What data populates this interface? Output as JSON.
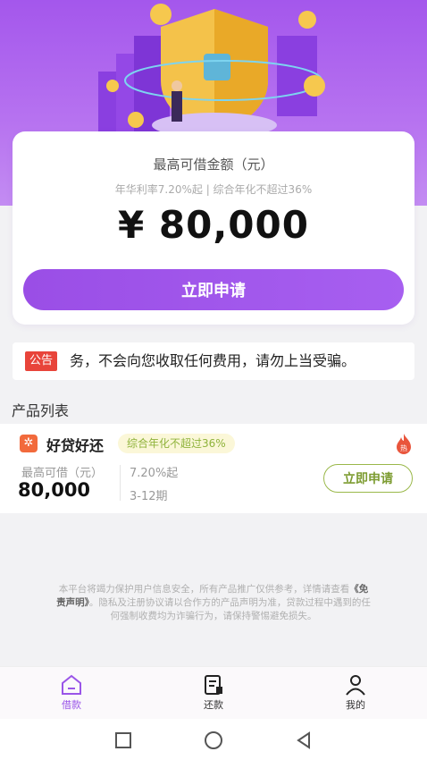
{
  "hero": {
    "max_label": "最高可借金额（元）",
    "rate_line": "年华利率7.20%起 | 综合年化不超过36%",
    "amount": "¥ 80,000",
    "apply_label": "立即申请"
  },
  "notice": {
    "tag": "公告",
    "text": "务，不会向您收取任何费用，请勿上当受骗。"
  },
  "products": {
    "title": "产品列表",
    "items": [
      {
        "name": "好贷好还",
        "badge": "综合年化不超过36%",
        "max_label": "最高可借（元）",
        "amount": "80,000",
        "rate": "7.20%起",
        "term": "3-12期",
        "apply_label": "立即申请",
        "hot_label": "热"
      }
    ]
  },
  "disclaimer": {
    "line_a": "本平台将竭力保护用户信息安全，所有产品推广仅供参考，详情请查看",
    "link": "《免责声明》",
    "line_b": "。隐私及注册协议请以合作方的产品声明为准，贷款过程中遇到的任何强制收费均为诈骗行为，请保持警惕避免损失。"
  },
  "tabs": [
    {
      "label": "借款",
      "icon": "home-icon",
      "active": true
    },
    {
      "label": "还款",
      "icon": "bill-icon",
      "active": false
    },
    {
      "label": "我的",
      "icon": "person-icon",
      "active": false
    }
  ],
  "colors": {
    "brand": "#a457ec",
    "accent_green": "#8fb33b",
    "notice_red": "#e8443a"
  }
}
